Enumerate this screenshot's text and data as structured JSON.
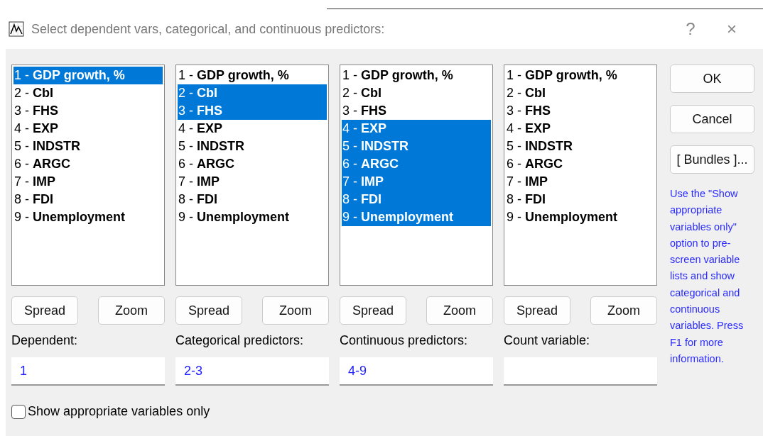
{
  "window": {
    "title": "Select dependent vars, categorical, and continuous predictors:",
    "help": "?",
    "close": "×"
  },
  "lists": [
    {
      "items": [
        {
          "label": "1 - **GDP growth, %**",
          "selected": true
        },
        {
          "label": "2 - **CbI**",
          "selected": false
        },
        {
          "label": "3 - **FHS**",
          "selected": false
        },
        {
          "label": "4 - **EXP**",
          "selected": false
        },
        {
          "label": "5 - **INDSTR**",
          "selected": false
        },
        {
          "label": "6 - **ARGC**",
          "selected": false
        },
        {
          "label": "7 - **IMP**",
          "selected": false
        },
        {
          "label": "8 - **FDI**",
          "selected": false
        },
        {
          "label": "9 - **Unemployment**",
          "selected": false
        }
      ],
      "buttons": [
        "Spread",
        "Zoom"
      ],
      "field_label": "Dependent:",
      "value": "1"
    },
    {
      "items": [
        {
          "label": "1 - **GDP growth, %**",
          "selected": false
        },
        {
          "label": "2 - **CbI**",
          "selected": true
        },
        {
          "label": "3 - **FHS**",
          "selected": true
        },
        {
          "label": "4 - **EXP**",
          "selected": false
        },
        {
          "label": "5 - **INDSTR**",
          "selected": false
        },
        {
          "label": "6 - **ARGC**",
          "selected": false
        },
        {
          "label": "7 - **IMP**",
          "selected": false
        },
        {
          "label": "8 - **FDI**",
          "selected": false
        },
        {
          "label": "9 - **Unemployment**",
          "selected": false
        }
      ],
      "buttons": [
        "Spread",
        "Zoom"
      ],
      "field_label": "Categorical predictors:",
      "value": "2-3"
    },
    {
      "items": [
        {
          "label": "1 - **GDP growth, %**",
          "selected": false
        },
        {
          "label": "2 - **CbI**",
          "selected": false
        },
        {
          "label": "3 - **FHS**",
          "selected": false
        },
        {
          "label": "4 - **EXP**",
          "selected": true
        },
        {
          "label": "5 - **INDSTR**",
          "selected": true
        },
        {
          "label": "6 - **ARGC**",
          "selected": true
        },
        {
          "label": "7 - **IMP**",
          "selected": true
        },
        {
          "label": "8 - **FDI**",
          "selected": true
        },
        {
          "label": "9 - **Unemployment**",
          "selected": true
        }
      ],
      "buttons": [
        "Spread",
        "Zoom"
      ],
      "field_label": "Continuous predictors:",
      "value": "4-9"
    },
    {
      "items": [
        {
          "label": "1 - **GDP growth, %**",
          "selected": false
        },
        {
          "label": "2 - **CbI**",
          "selected": false
        },
        {
          "label": "3 - **FHS**",
          "selected": false
        },
        {
          "label": "4 - **EXP**",
          "selected": false
        },
        {
          "label": "5 - **INDSTR**",
          "selected": false
        },
        {
          "label": "6 - **ARGC**",
          "selected": false
        },
        {
          "label": "7 - **IMP**",
          "selected": false
        },
        {
          "label": "8 - **FDI**",
          "selected": false
        },
        {
          "label": "9 - **Unemployment**",
          "selected": false
        }
      ],
      "buttons": [
        "Spread",
        "Zoom"
      ],
      "field_label": "Count variable:"
    }
  ],
  "side_buttons": [
    "OK",
    "Cancel",
    "[ Bundles ]..."
  ],
  "hint": "Use the \"Show appropriate variables only\" option to pre-screen variable lists and show categorical and continuous variables. Press F1 for more information.",
  "option": {
    "label": "Show appropriate variables only",
    "checked": false
  }
}
